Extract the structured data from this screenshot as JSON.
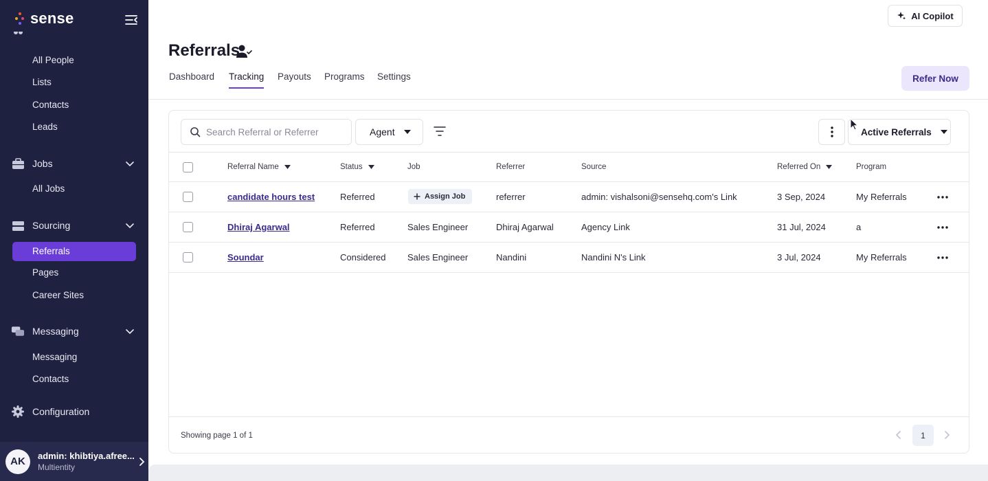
{
  "brand": {
    "name": "sense"
  },
  "sidebar": {
    "people_items": [
      "All People",
      "Lists",
      "Contacts",
      "Leads"
    ],
    "jobs": {
      "label": "Jobs",
      "icon": "briefcase-icon",
      "items": [
        "All Jobs"
      ]
    },
    "sourcing": {
      "label": "Sourcing",
      "icon": "layers-icon",
      "items": [
        "Referrals",
        "Pages",
        "Career Sites"
      ],
      "active": "Referrals"
    },
    "messaging": {
      "label": "Messaging",
      "icon": "chat-icon",
      "items": [
        "Messaging",
        "Contacts"
      ]
    },
    "configuration": {
      "label": "Configuration",
      "icon": "gear-icon"
    },
    "user": {
      "initials": "AK",
      "name": "admin: khibtiya.afree...",
      "org": "Multientity"
    }
  },
  "header": {
    "copilot_label": "AI Copilot",
    "title": "Referrals",
    "tabs": [
      "Dashboard",
      "Tracking",
      "Payouts",
      "Programs",
      "Settings"
    ],
    "active_tab": "Tracking",
    "refer_now_label": "Refer Now"
  },
  "toolbar": {
    "search_placeholder": "Search Referral or Referrer",
    "agent_label": "Agent",
    "view_label": "Active Referrals"
  },
  "table": {
    "columns": [
      "Referral Name",
      "Status",
      "Job",
      "Referrer",
      "Source",
      "Referred On",
      "Program"
    ],
    "rows": [
      {
        "name": "candidate hours test",
        "status": "Referred",
        "job": "Assign Job",
        "job_is_action": true,
        "referrer": "referrer",
        "source": "admin: vishalsoni@sensehq.com's Link",
        "referred_on": "3 Sep, 2024",
        "program": "My Referrals"
      },
      {
        "name": "Dhiraj Agarwal",
        "status": "Referred",
        "job": "Sales Engineer",
        "job_is_action": false,
        "referrer": "Dhiraj Agarwal",
        "source": "Agency Link",
        "referred_on": "31 Jul, 2024",
        "program": "a"
      },
      {
        "name": "Soundar",
        "status": "Considered",
        "job": "Sales Engineer",
        "job_is_action": false,
        "referrer": "Nandini",
        "source": "Nandini N's Link",
        "referred_on": "3 Jul, 2024",
        "program": "My Referrals"
      }
    ]
  },
  "pagination": {
    "info": "Showing page 1 of 1",
    "current": "1"
  },
  "colors": {
    "sidebar_bg": "#1f2140",
    "accent": "#6a3cd8",
    "link": "#3c2a8c"
  }
}
